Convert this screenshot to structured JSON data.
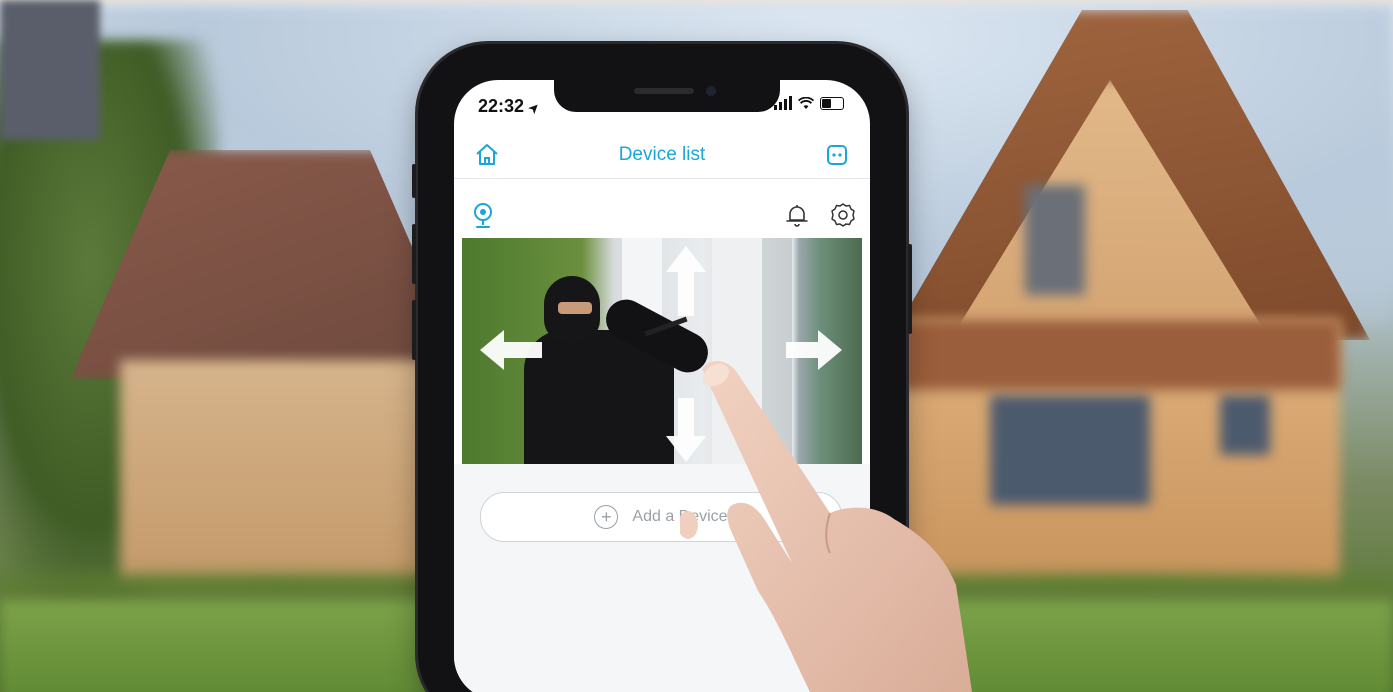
{
  "status_bar": {
    "time": "22:32",
    "location_glyph": "➤"
  },
  "nav": {
    "title": "Device list",
    "home_icon": "home-icon",
    "right_icon": "plug-icon"
  },
  "device": {
    "camera_icon": "camera-icon",
    "bell_icon": "bell-icon",
    "settings_icon": "gear-icon"
  },
  "add_device": {
    "label": "Add a Device",
    "icon": "plus-circle-icon"
  },
  "colors": {
    "accent": "#1aa6d8",
    "border": "#cfd4d9",
    "muted_text": "#9aa0a6"
  }
}
